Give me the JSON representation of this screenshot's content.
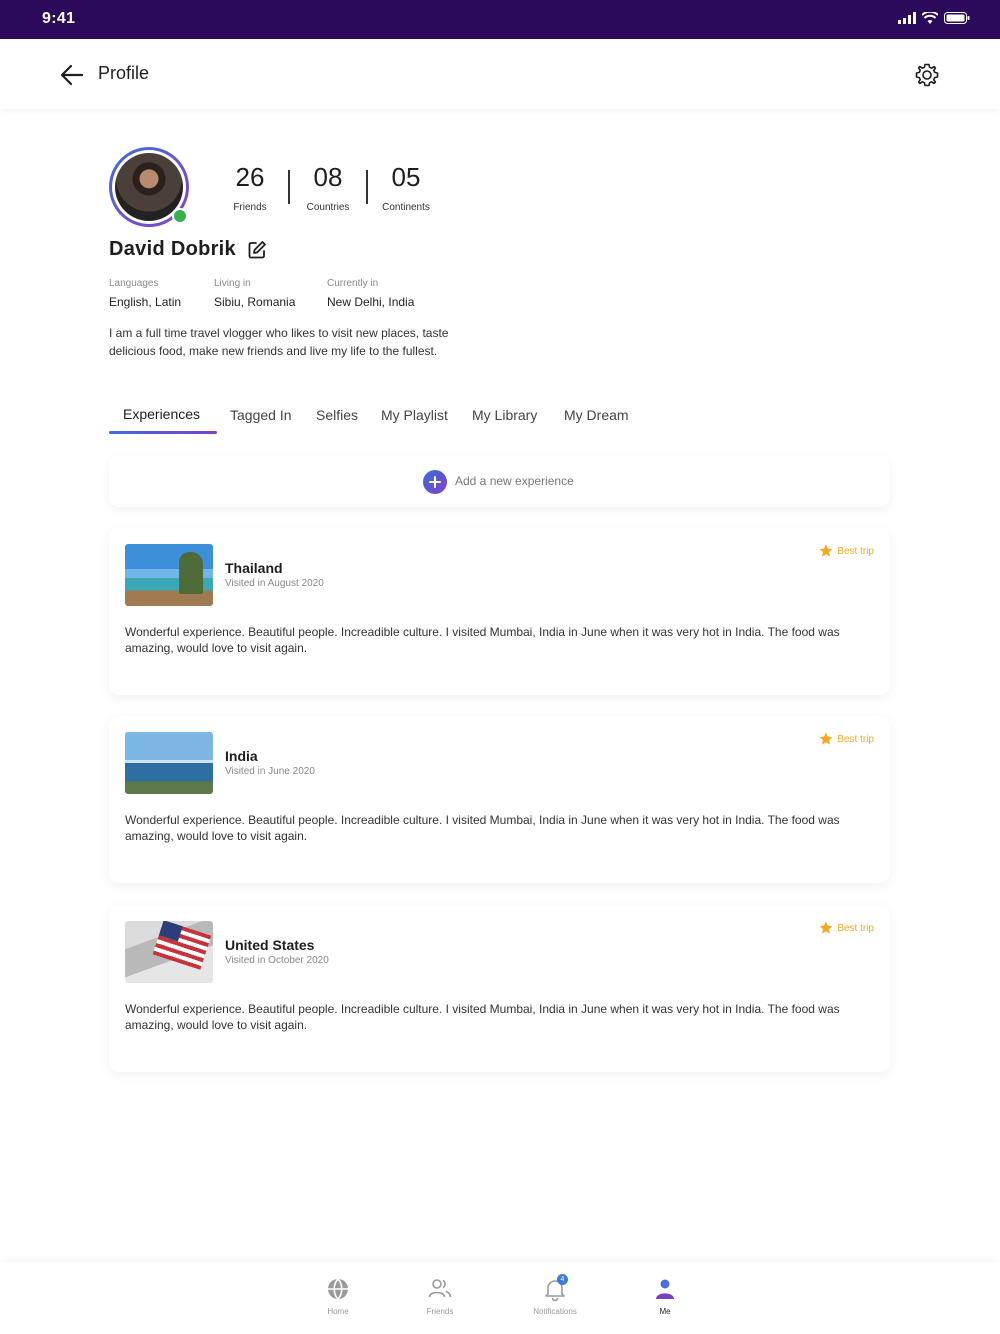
{
  "status_bar": {
    "time": "9:41"
  },
  "header": {
    "title": "Profile"
  },
  "profile": {
    "name": "David Dobrik",
    "stats": [
      {
        "value": "26",
        "label": "Friends"
      },
      {
        "value": "08",
        "label": "Countries"
      },
      {
        "value": "05",
        "label": "Continents"
      }
    ],
    "info": [
      {
        "label": "Languages",
        "value": "English, Latin"
      },
      {
        "label": "Living in",
        "value": "Sibiu, Romania"
      },
      {
        "label": "Currently in",
        "value": "New Delhi, India"
      }
    ],
    "bio": "I am a full time travel vlogger who likes to visit new places, taste delicious food, make new friends and live my life to the fullest."
  },
  "tabs": [
    {
      "label": "Experiences",
      "active": true
    },
    {
      "label": "Tagged In",
      "active": false
    },
    {
      "label": "Selfies",
      "active": false
    },
    {
      "label": "My Playlist",
      "active": false
    },
    {
      "label": "My Library",
      "active": false
    },
    {
      "label": "My Dream",
      "active": false
    }
  ],
  "add_experience": {
    "label": "Add a new experience"
  },
  "experiences": [
    {
      "title": "Thailand",
      "visited": "Visited in August 2020",
      "badge": "Best trip",
      "text": "Wonderful experience. Beautiful people. Increadible culture. I visited Mumbai, India in June when it was very hot in India. The food was amazing, would love to visit again."
    },
    {
      "title": "India",
      "visited": "Visited in June 2020",
      "badge": "Best trip",
      "text": "Wonderful experience. Beautiful people. Increadible culture. I visited Mumbai, India in June when it was very hot in India. The food was amazing, would love to visit again."
    },
    {
      "title": "United States",
      "visited": "Visited in October 2020",
      "badge": "Best trip",
      "text": "Wonderful experience. Beautiful people. Increadible culture. I visited Mumbai, India in June when it was very hot in India. The food was amazing, would love to visit again."
    }
  ],
  "bottom_nav": {
    "items": [
      {
        "label": "Home",
        "icon": "globe-icon"
      },
      {
        "label": "Friends",
        "icon": "friends-icon"
      },
      {
        "label": "Notifications",
        "icon": "bell-icon",
        "badge": "4"
      },
      {
        "label": "Me",
        "icon": "user-icon",
        "active": true
      }
    ]
  },
  "colors": {
    "status_bar": "#2c0a5b",
    "accent_start": "#3b6fd9",
    "accent_end": "#7e3fc9",
    "badge": "#f5a623",
    "online": "#36b24a"
  }
}
